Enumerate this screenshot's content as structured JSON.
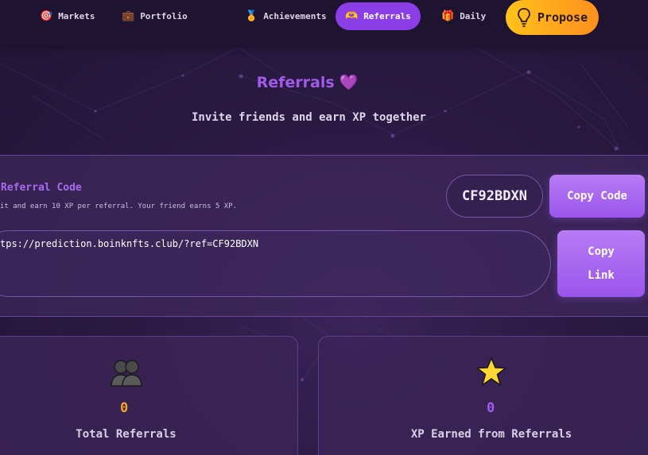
{
  "nav": {
    "items": [
      {
        "label": "Markets",
        "icon": "target-icon"
      },
      {
        "label": "Portfolio",
        "icon": "briefcase-icon"
      },
      {
        "label": "Achievements",
        "icon": "medal-icon"
      },
      {
        "label": "Referrals",
        "icon": "heart-hands-icon",
        "active": true
      },
      {
        "label": "Daily",
        "icon": "gift-icon"
      }
    ],
    "propose_label": "Propose"
  },
  "header": {
    "title": "Referrals",
    "subtitle": "Invite friends and earn XP together"
  },
  "referral": {
    "label": "Referral Code",
    "description": "it and earn 10 XP per referral. Your friend earns 5 XP.",
    "code": "CF92BDXN",
    "copy_code_label": "Copy Code",
    "link": "tps://prediction.boinknfts.club/?ref=CF92BDXN",
    "copy_link_line1": "Copy",
    "copy_link_line2": "Link"
  },
  "stats": [
    {
      "value": "0",
      "label": "Total Referrals",
      "icon": "people-icon",
      "color": "#f5a623"
    },
    {
      "value": "0",
      "label": "XP Earned from Referrals",
      "icon": "star-icon",
      "color": "#a35cf0"
    }
  ],
  "colors": {
    "accent": "#8b3ee6",
    "propose_start": "#ffc21a",
    "propose_end": "#ff8f1f"
  }
}
